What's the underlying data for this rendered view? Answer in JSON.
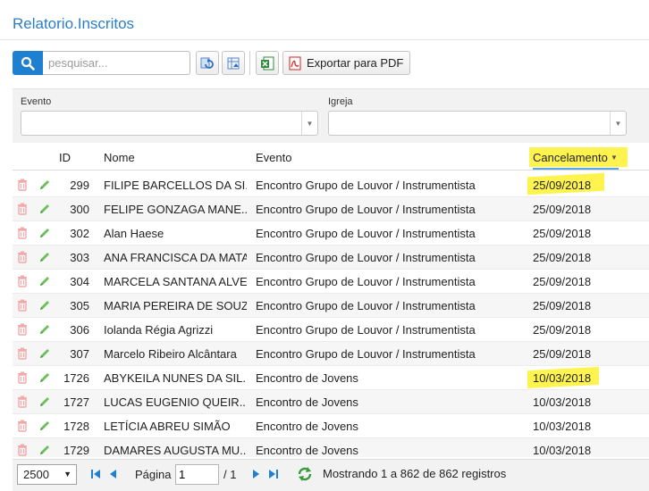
{
  "page": {
    "title": "Relatorio.Inscritos"
  },
  "toolbar": {
    "search_placeholder": "pesquisar...",
    "pdf_label": "Exportar para PDF",
    "icons": [
      "search-icon",
      "refresh-icon",
      "column-chooser-icon",
      "excel-icon",
      "pdf-icon"
    ],
    "accent_color": "#1f7fd0"
  },
  "filters": {
    "evento_label": "Evento",
    "igreja_label": "Igreja"
  },
  "grid": {
    "columns": {
      "id": "ID",
      "nome": "Nome",
      "evento": "Evento",
      "cancelamento": "Cancelamento"
    },
    "rows": [
      {
        "id": "299",
        "nome": "FILIPE BARCELLOS DA SI...",
        "evento": "Encontro Grupo de Louvor / Instrumentista",
        "cancelamento": "25/09/2018"
      },
      {
        "id": "300",
        "nome": "FELIPE GONZAGA MANE...",
        "evento": "Encontro Grupo de Louvor / Instrumentista",
        "cancelamento": "25/09/2018"
      },
      {
        "id": "302",
        "nome": "Alan Haese",
        "evento": "Encontro Grupo de Louvor / Instrumentista",
        "cancelamento": "25/09/2018"
      },
      {
        "id": "303",
        "nome": "ANA FRANCISCA DA MATA",
        "evento": "Encontro Grupo de Louvor / Instrumentista",
        "cancelamento": "25/09/2018"
      },
      {
        "id": "304",
        "nome": "MARCELA SANTANA ALVES",
        "evento": "Encontro Grupo de Louvor / Instrumentista",
        "cancelamento": "25/09/2018"
      },
      {
        "id": "305",
        "nome": "MARIA PEREIRA DE SOUZA",
        "evento": "Encontro Grupo de Louvor / Instrumentista",
        "cancelamento": "25/09/2018"
      },
      {
        "id": "306",
        "nome": "Iolanda Régia Agrizzi",
        "evento": "Encontro Grupo de Louvor / Instrumentista",
        "cancelamento": "25/09/2018"
      },
      {
        "id": "307",
        "nome": "Marcelo Ribeiro Alcântara",
        "evento": "Encontro Grupo de Louvor / Instrumentista",
        "cancelamento": "25/09/2018"
      },
      {
        "id": "1726",
        "nome": "ABYKEILA NUNES DA SIL...",
        "evento": "Encontro de Jovens",
        "cancelamento": "10/03/2018"
      },
      {
        "id": "1727",
        "nome": "LUCAS EUGENIO QUEIR...",
        "evento": "Encontro de Jovens",
        "cancelamento": "10/03/2018"
      },
      {
        "id": "1728",
        "nome": "LETÍCIA ABREU SIMÃO",
        "evento": "Encontro de Jovens",
        "cancelamento": "10/03/2018"
      },
      {
        "id": "1729",
        "nome": "DAMARES AUGUSTA MU...",
        "evento": "Encontro de Jovens",
        "cancelamento": "10/03/2018"
      }
    ],
    "highlight_color": "#fff44f"
  },
  "pager": {
    "page_size": "2500",
    "page_label": "Página",
    "page_value": "1",
    "page_total": "/ 1",
    "status": "Mostrando 1 a 862 de 862 registros"
  }
}
